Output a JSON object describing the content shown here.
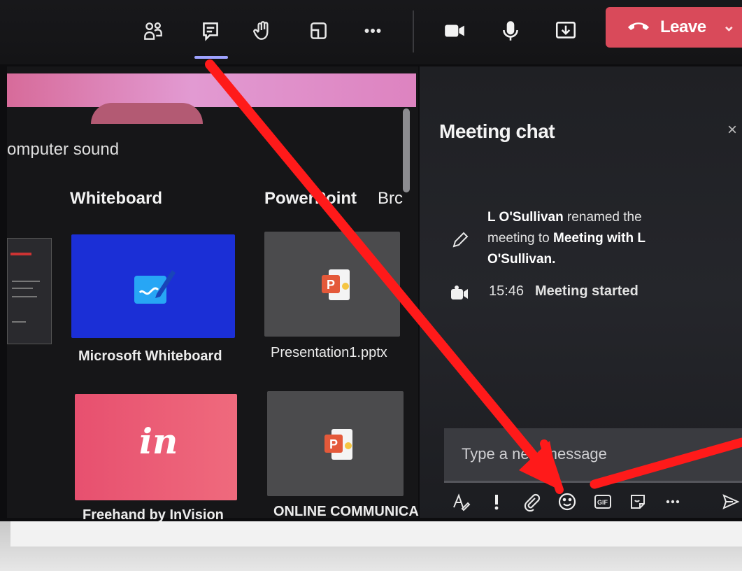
{
  "top_bar": {
    "leave_label": "Leave",
    "colors": {
      "leave_button": "#d94a5a",
      "active_underline": "#9ea2ff"
    },
    "icons": [
      "people-icon",
      "chat-icon",
      "raise-hand-icon",
      "rooms-icon",
      "more-icon",
      "camera-icon",
      "mic-icon",
      "share-screen-icon",
      "hangup-icon",
      "chevron-down-icon"
    ]
  },
  "share_panel": {
    "computer_sound_label": "omputer sound",
    "sections": {
      "whiteboard": "Whiteboard",
      "powerpoint": "PowerPoint",
      "browse": "Brc"
    },
    "whiteboard_tiles": [
      {
        "label": "Microsoft Whiteboard",
        "color": "#1b2fd6"
      },
      {
        "label": "Freehand by InVision",
        "color": "#e94d6d",
        "logo_text": "in"
      }
    ],
    "powerpoint_tiles": [
      {
        "label": "Presentation1.pptx"
      },
      {
        "label": "ONLINE COMMUNICA"
      }
    ]
  },
  "chat": {
    "title": "Meeting chat",
    "close_glyph": "×",
    "messages": [
      {
        "icon": "pencil-icon",
        "actor": "L O'Sullivan",
        "text1": " renamed the meeting to ",
        "new_name": "Meeting with L O'Sullivan."
      },
      {
        "icon": "meeting-icon",
        "time": "15:46",
        "text": "Meeting started"
      }
    ],
    "compose_placeholder": "Type a new message",
    "compose_icons": [
      "format-icon",
      "important-icon",
      "attach-icon",
      "emoji-icon",
      "gif-icon",
      "sticker-icon",
      "more-icon",
      "send-icon"
    ]
  },
  "annotation_colors": {
    "arrow": "#ff1a1a"
  }
}
